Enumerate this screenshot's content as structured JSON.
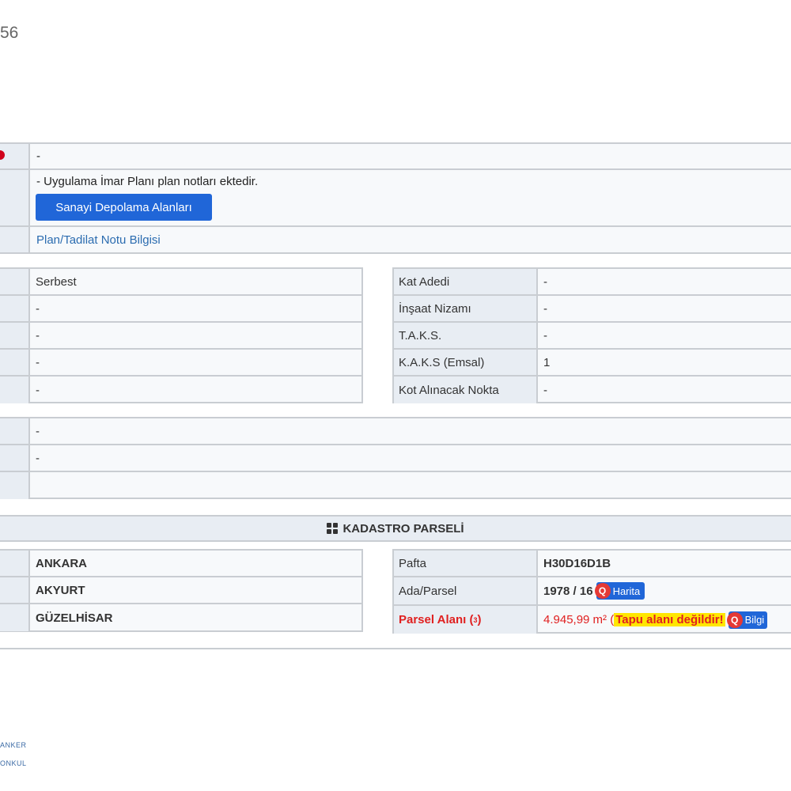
{
  "header": {
    "partial_number": "56"
  },
  "top_section": {
    "row1_value": "-",
    "row2_note": "- Uygulama İmar Planı plan notları ektedir.",
    "row2_button": "Sanayi Depolama Alanları",
    "row3_link": "Plan/Tadilat Notu Bilgisi"
  },
  "left_table": {
    "values": [
      "Serbest",
      "-",
      "-",
      "-",
      "-"
    ]
  },
  "right_table": {
    "rows": [
      {
        "key": "Kat Adedi",
        "value": "-"
      },
      {
        "key": "İnşaat Nizamı",
        "value": "-"
      },
      {
        "key": "T.A.K.S.",
        "value": "-"
      },
      {
        "key": "K.A.K.S (Emsal)",
        "value": "1"
      },
      {
        "key": "Kot Alınacak Nokta",
        "value": "-"
      }
    ]
  },
  "mid_rows": {
    "values": [
      "-",
      "-",
      ""
    ]
  },
  "kadastro": {
    "heading": "KADASTRO PARSELİ",
    "left_values": [
      "ANKARA",
      "AKYURT",
      "GÜZELHİSAR"
    ],
    "pafta_label": "Pafta",
    "pafta_value": "H30D16D1B",
    "ada_label": "Ada/Parsel",
    "ada_value": "1978 / 16",
    "harita_label": "Harita",
    "alan_label": "Parsel Alanı (",
    "alan_sup": "3",
    "alan_label_end": ")",
    "alan_value": "4.945,99 m² (",
    "alan_warning": "Tapu alanı değildir!",
    "bilgi_label": "Bilgi"
  },
  "footer": {
    "line1": "ANKER",
    "line2": "ONKUL"
  },
  "colors": {
    "accent": "#2066d8",
    "danger": "#e02020",
    "highlight": "#ffe600"
  },
  "icons": [
    "q-icon",
    "grid-icon"
  ]
}
